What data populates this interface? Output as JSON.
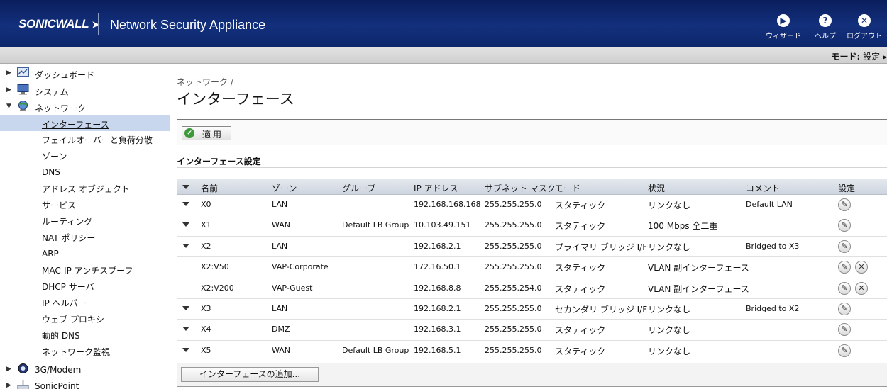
{
  "header": {
    "logo": "SONICWALL",
    "title": "Network Security Appliance",
    "wizard_label": "ウィザード",
    "help_label": "ヘルプ",
    "logout_label": "ログアウト"
  },
  "modebar": {
    "mode_label": "モード:",
    "mode_value": "設定 ▸"
  },
  "sidebar": {
    "top_items": [
      {
        "label": "ダッシュボード",
        "icon": "chart-icon",
        "state": "collapsed"
      },
      {
        "label": "システム",
        "icon": "monitor-icon",
        "state": "collapsed"
      },
      {
        "label": "ネットワーク",
        "icon": "globe-icon",
        "state": "expanded"
      },
      {
        "label": "3G/Modem",
        "icon": "modem-icon",
        "state": "collapsed"
      },
      {
        "label": "SonicPoint",
        "icon": "sonicpoint-icon",
        "state": "collapsed"
      }
    ],
    "network_items": [
      "インターフェース",
      "フェイルオーバーと負荷分散",
      "ゾーン",
      "DNS",
      "アドレス オブジェクト",
      "サービス",
      "ルーティング",
      "NAT ポリシー",
      "ARP",
      "MAC-IP アンチスプーフ",
      "DHCP サーバ",
      "IP ヘルパー",
      "ウェブ プロキシ",
      "動的 DNS",
      "ネットワーク監視"
    ],
    "active_index": 0
  },
  "main": {
    "breadcrumb": "ネットワーク /",
    "title": "インターフェース",
    "apply_label": "適用",
    "section_title": "インターフェース設定",
    "add_button": "インターフェースの追加..."
  },
  "table": {
    "headers": [
      "名前",
      "ゾーン",
      "グループ",
      "IP アドレス",
      "サブネット マスク",
      "モード",
      "状況",
      "コメント",
      "設定"
    ],
    "rows": [
      {
        "name": "X0",
        "zone": "LAN",
        "group": "",
        "ip": "192.168.168.168",
        "mask": "255.255.255.0",
        "mode": "スタティック",
        "status": "リンクなし",
        "comment": "Default LAN",
        "expandable": true,
        "deletable": false
      },
      {
        "name": "X1",
        "zone": "WAN",
        "group": "Default LB Group",
        "ip": "10.103.49.151",
        "mask": "255.255.255.0",
        "mode": "スタティック",
        "status": "100 Mbps 全二重",
        "comment": "",
        "expandable": true,
        "deletable": false
      },
      {
        "name": "X2",
        "zone": "LAN",
        "group": "",
        "ip": "192.168.2.1",
        "mask": "255.255.255.0",
        "mode": "プライマリ ブリッジ I/F",
        "status": "リンクなし",
        "comment": "Bridged to X3",
        "expandable": true,
        "deletable": false
      },
      {
        "name": "X2:V50",
        "zone": "VAP-Corporate",
        "group": "",
        "ip": "172.16.50.1",
        "mask": "255.255.255.0",
        "mode": "スタティック",
        "status": "VLAN 副インターフェース",
        "comment": "",
        "expandable": false,
        "deletable": true
      },
      {
        "name": "X2:V200",
        "zone": "VAP-Guest",
        "group": "",
        "ip": "192.168.8.8",
        "mask": "255.255.254.0",
        "mode": "スタティック",
        "status": "VLAN 副インターフェース",
        "comment": "",
        "expandable": false,
        "deletable": true
      },
      {
        "name": "X3",
        "zone": "LAN",
        "group": "",
        "ip": "192.168.2.1",
        "mask": "255.255.255.0",
        "mode": "セカンダリ ブリッジ I/F",
        "status": "リンクなし",
        "comment": "Bridged to X2",
        "expandable": true,
        "deletable": false
      },
      {
        "name": "X4",
        "zone": "DMZ",
        "group": "",
        "ip": "192.168.3.1",
        "mask": "255.255.255.0",
        "mode": "スタティック",
        "status": "リンクなし",
        "comment": "",
        "expandable": true,
        "deletable": false
      },
      {
        "name": "X5",
        "zone": "WAN",
        "group": "Default LB Group",
        "ip": "192.168.5.1",
        "mask": "255.255.255.0",
        "mode": "スタティック",
        "status": "リンクなし",
        "comment": "",
        "expandable": true,
        "deletable": false
      }
    ]
  }
}
